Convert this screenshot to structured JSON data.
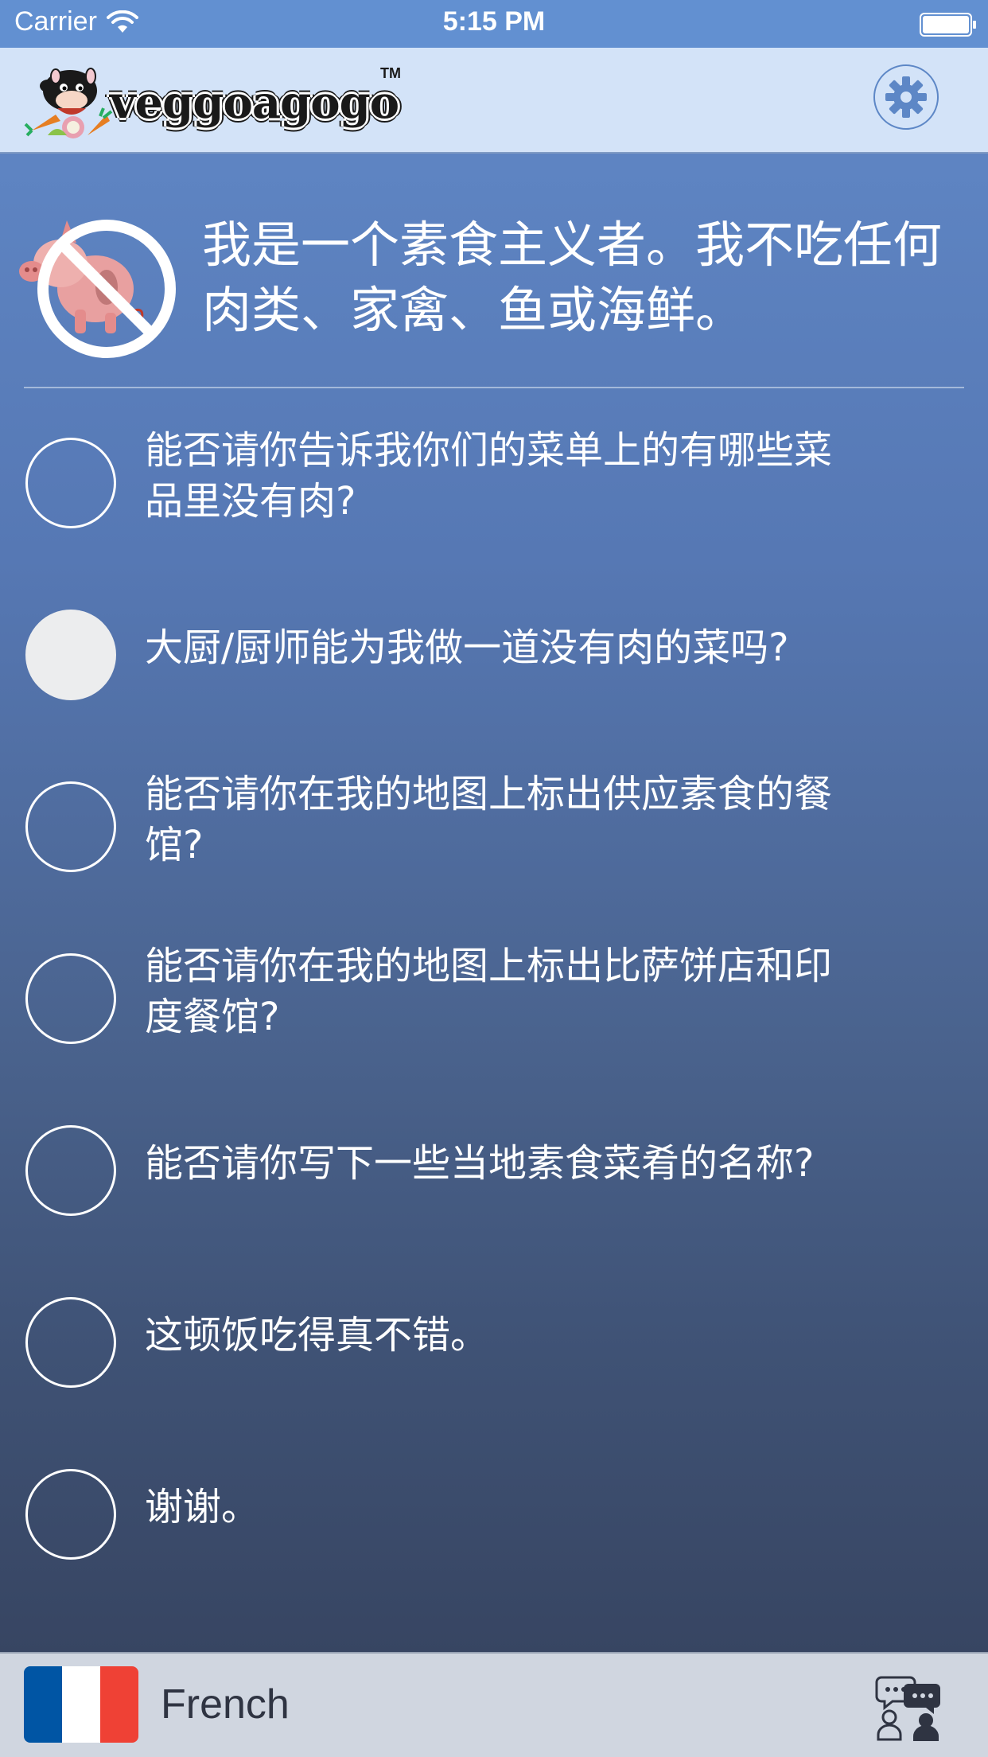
{
  "status_bar": {
    "carrier": "Carrier",
    "time": "5:15 PM"
  },
  "header": {
    "logo_text": "veggoagogo",
    "logo_tm": "TM",
    "settings_icon": "gear-icon"
  },
  "intro": {
    "icon": "no-meat-pig-icon",
    "text": "我是一个素食主义者。我不吃任何肉类、家禽、鱼或海鲜。"
  },
  "phrases": [
    {
      "lines": [
        "能否请你告诉我你们的菜单上的有哪些菜",
        "品里没有肉?"
      ],
      "selected": false
    },
    {
      "lines": [
        "大厨/厨师能为我做一道没有肉的菜吗?"
      ],
      "selected": true
    },
    {
      "lines": [
        "能否请你在我的地图上标出供应素食的餐",
        "馆?"
      ],
      "selected": false
    },
    {
      "lines": [
        "能否请你在我的地图上标出比萨饼店和印",
        "度餐馆?"
      ],
      "selected": false
    },
    {
      "lines": [
        "能否请你写下一些当地素食菜肴的名称?"
      ],
      "selected": false
    },
    {
      "lines": [
        "这顿饭吃得真不错。"
      ],
      "selected": false
    },
    {
      "lines": [
        "谢谢。"
      ],
      "selected": false
    }
  ],
  "bottom_bar": {
    "language": "French",
    "flag_colors": [
      "#0055a4",
      "#ffffff",
      "#ef4135"
    ],
    "chat_icon": "conversation-icon"
  },
  "colors": {
    "status_bar": "#6290d1",
    "header_bg": "#d3e3f8",
    "accent": "#5d87c6",
    "text_light": "#ffffff",
    "bottom_bar_bg": "#d0d6e0"
  }
}
